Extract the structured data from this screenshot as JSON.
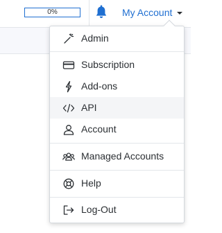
{
  "header": {
    "progress": {
      "percent": 0,
      "label": "0%"
    },
    "notifications_icon": "bell-icon",
    "account_label": "My Account"
  },
  "menu": {
    "items": [
      {
        "label": "Admin",
        "icon": "magic-wand-icon"
      },
      {
        "label": "Subscription",
        "icon": "credit-card-icon"
      },
      {
        "label": "Add-ons",
        "icon": "plug-icon"
      },
      {
        "label": "API",
        "icon": "code-icon",
        "highlighted": true
      },
      {
        "label": "Account",
        "icon": "user-icon"
      },
      {
        "label": "Managed Accounts",
        "icon": "users-icon"
      },
      {
        "label": "Help",
        "icon": "lifebuoy-icon"
      },
      {
        "label": "Log-Out",
        "icon": "logout-icon"
      }
    ]
  },
  "colors": {
    "accent": "#1f6fd1",
    "text": "#2b2f33",
    "highlight": "#f4f5f7",
    "border": "#d4d8dd"
  }
}
